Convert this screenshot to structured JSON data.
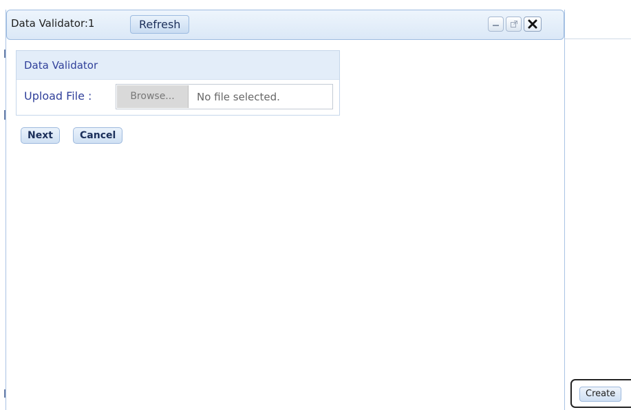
{
  "portlet": {
    "title": "Data Validator:1",
    "refresh_label": "Refresh",
    "controls": {
      "minimize_icon": "minimize-icon",
      "popout_icon": "popout-icon",
      "close_icon": "close-icon"
    }
  },
  "validator": {
    "header": "Data Validator",
    "upload_label": "Upload File :",
    "browse_label": "Browse...",
    "file_status": "No file selected."
  },
  "actions": {
    "next_label": "Next",
    "cancel_label": "Cancel"
  },
  "sidebar": {
    "create_label": "Create"
  },
  "colors": {
    "title_bar": "#dbe8f7",
    "label_text": "#30409a",
    "button_bg": "#cfe0f3"
  }
}
